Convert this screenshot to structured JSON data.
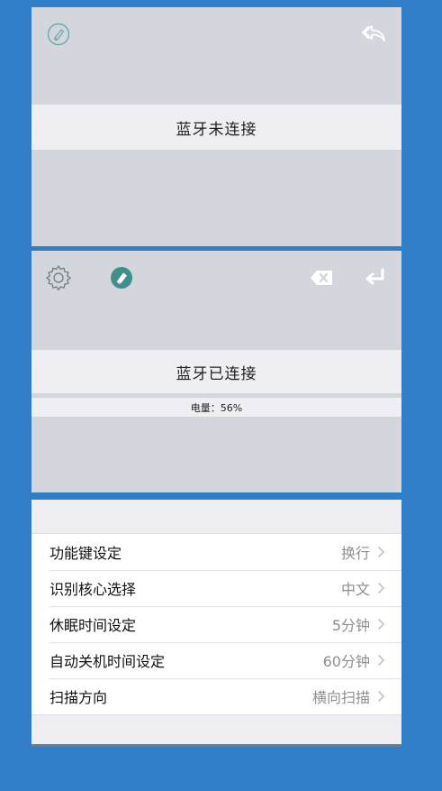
{
  "panel_disconnected": {
    "status_text": "蓝牙未连接",
    "left_icon": "broom-clean-icon",
    "right_icon": "reply-back-icon"
  },
  "panel_connected": {
    "status_text": "蓝牙已连接",
    "battery_text": "电量：56%",
    "battery_level_percent": 56,
    "icons": [
      "gear-icon",
      "eraser-icon",
      "backspace-icon",
      "return-enter-icon"
    ]
  },
  "settings": {
    "items": [
      {
        "label": "功能键设定",
        "value": "换行"
      },
      {
        "label": "识别核心选择",
        "value": "中文"
      },
      {
        "label": "休眠时间设定",
        "value": "5分钟"
      },
      {
        "label": "自动关机时间设定",
        "value": "60分钟"
      },
      {
        "label": "扫描方向",
        "value": "横向扫描"
      }
    ]
  },
  "colors": {
    "background": "#2f7fc8",
    "panel": "#d3d6dd",
    "status_bar": "#efeff3",
    "teal_accent": "#3f8f8c",
    "value_gray": "#8e8e93"
  }
}
